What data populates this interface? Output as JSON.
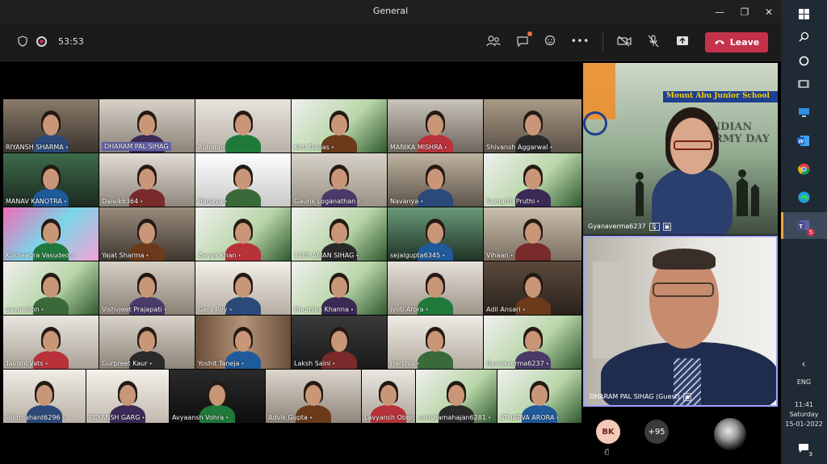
{
  "window": {
    "title": "General"
  },
  "toolbar": {
    "timer": "53:53",
    "leave_label": "Leave"
  },
  "gallery": {
    "tiles": [
      {
        "label": "RIYANSH SHARMA",
        "hl": false
      },
      {
        "label": "DHARAM PAL SIHAG",
        "hl": true
      },
      {
        "label": "Ruhani",
        "hl": false
      },
      {
        "label": "Kirti Dabas",
        "hl": false
      },
      {
        "label": "MANIKA MISHRA",
        "hl": false
      },
      {
        "label": "Shivansh Aggarwal",
        "hl": false
      },
      {
        "label": "MANAV KANOTRA",
        "hl": false
      },
      {
        "label": "Daivik6364",
        "hl": false
      },
      {
        "label": "Hanaya",
        "hl": false
      },
      {
        "label": "Gaurik Loganathan",
        "hl": false
      },
      {
        "label": "Navanya",
        "hl": false
      },
      {
        "label": "Samarth Pruthi",
        "hl": false
      },
      {
        "label": "Kushaagra Vasudeo",
        "hl": false
      },
      {
        "label": "Yajat Sharma",
        "hl": false
      },
      {
        "label": "Zavya Khan",
        "hl": false
      },
      {
        "label": "3105 AMAN SIHAG",
        "hl": false
      },
      {
        "label": "sejalgupta6345",
        "hl": false
      },
      {
        "label": "Vihaan",
        "hl": false
      },
      {
        "label": "payal joon",
        "hl": false
      },
      {
        "label": "Vishvjeet Prajapati",
        "hl": false
      },
      {
        "label": "Garv Roy",
        "hl": false
      },
      {
        "label": "Bhumika Khanna",
        "hl": false
      },
      {
        "label": "Jyoti Arora",
        "hl": false
      },
      {
        "label": "Adil Ansari",
        "hl": false
      },
      {
        "label": "Tavishi Vats",
        "hl": false
      },
      {
        "label": "Gurpreet Kaur",
        "hl": false
      },
      {
        "label": "Yoshit Taneja",
        "hl": false
      },
      {
        "label": "Laksh Saini",
        "hl": false
      },
      {
        "label": "Harshul",
        "hl": false
      },
      {
        "label": "Gyanaverma6237",
        "hl": false
      },
      {
        "label": "Uditmahant6296",
        "hl": false
      },
      {
        "label": "REYANSH GARG",
        "hl": false
      },
      {
        "label": "Avyaansh Vohra",
        "hl": false
      },
      {
        "label": "Advik Gupta",
        "hl": false
      },
      {
        "label": "Lavyansh Oberoi",
        "hl": false
      },
      {
        "label": "sarishamahajan6281",
        "hl": false
      },
      {
        "label": "ATHARVA ARORA",
        "hl": false
      }
    ]
  },
  "banner": {
    "school": "Mount Abu Junior School",
    "event": "INDIAN ARMY DAY"
  },
  "spotlight": {
    "top": {
      "label": "Gyanaverma6237"
    },
    "bottom": {
      "label": "DHARAM PAL SIHAG (Guest)"
    }
  },
  "strip": {
    "initials": "BK",
    "more": "+95"
  },
  "taskbar": {
    "lang": "ENG",
    "time": "11:41",
    "day": "Saturday",
    "date": "15-01-2022",
    "teams_badge": "5",
    "notif_count": "3"
  },
  "colors": {
    "accent": "#6264a7",
    "leave": "#c4314b",
    "taskbar": "#202a35"
  }
}
